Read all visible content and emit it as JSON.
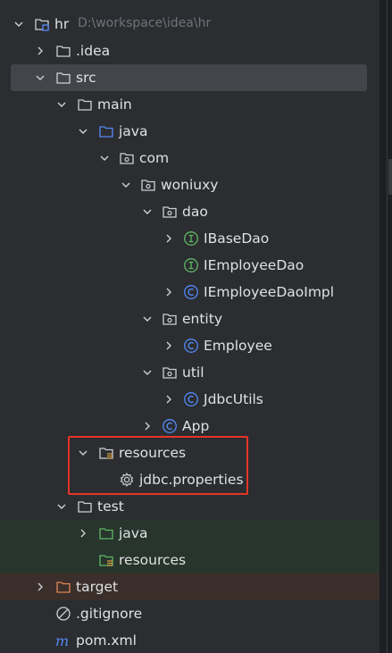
{
  "project_tree": {
    "root": {
      "label": "hr",
      "path_hint": "D:\\workspace\\idea\\hr"
    },
    "idea": {
      "label": ".idea"
    },
    "src": {
      "label": "src"
    },
    "main": {
      "label": "main"
    },
    "java_main": {
      "label": "java"
    },
    "com": {
      "label": "com"
    },
    "woniuxy": {
      "label": "woniuxy"
    },
    "dao": {
      "label": "dao"
    },
    "ibasedao": {
      "label": "IBaseDao"
    },
    "iemployeedao": {
      "label": "IEmployeeDao"
    },
    "iemployeedaoimpl": {
      "label": "IEmployeeDaoImpl"
    },
    "entity": {
      "label": "entity"
    },
    "employee": {
      "label": "Employee"
    },
    "util": {
      "label": "util"
    },
    "jdbcutils": {
      "label": "JdbcUtils"
    },
    "app": {
      "label": "App"
    },
    "resources_main": {
      "label": "resources"
    },
    "jdbc_properties": {
      "label": "jdbc.properties"
    },
    "test": {
      "label": "test"
    },
    "java_test": {
      "label": "java"
    },
    "resources_test": {
      "label": "resources"
    },
    "target": {
      "label": "target"
    },
    "gitignore": {
      "label": ".gitignore"
    },
    "pom": {
      "label": "pom.xml"
    }
  },
  "colors": {
    "background": "#2B2D30",
    "selected_row": "#43454A",
    "test_row": "#28352D",
    "target_row": "#3A2F2A",
    "interface_icon": "#5FB865",
    "class_icon": "#548AF7",
    "highlight_box": "#E5352A"
  }
}
